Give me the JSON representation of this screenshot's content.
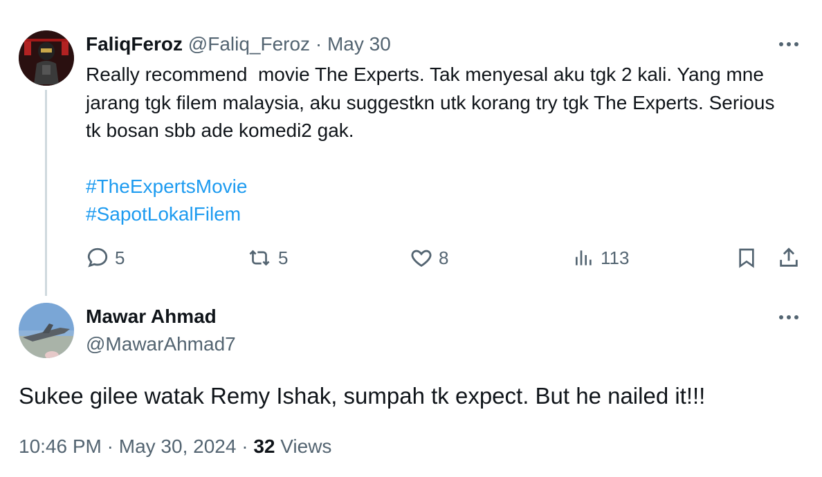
{
  "parent_tweet": {
    "display_name": "FaliqFeroz",
    "handle": "@Faliq_Feroz",
    "separator": "·",
    "date": "May 30",
    "text": "Really recommend  movie The Experts. Tak menyesal aku tgk 2 kali. Yang mne jarang tgk filem malaysia, aku suggestkn utk korang try tgk The Experts. Serious tk bosan sbb ade komedi2 gak.",
    "hashtags": [
      "#TheExpertsMovie",
      "#SapotLokalFilem"
    ],
    "actions": {
      "replies": "5",
      "reposts": "5",
      "likes": "8",
      "views": "113"
    }
  },
  "reply_tweet": {
    "display_name": "Mawar Ahmad",
    "handle": "@MawarAhmad7",
    "text": "Sukee gilee watak Remy Ishak, sumpah tk expect. But he nailed it!!!",
    "time": "10:46 PM",
    "separator": "·",
    "date": "May 30, 2024",
    "views_count": "32",
    "views_label": "Views"
  },
  "colors": {
    "text": "#0f1419",
    "muted": "#536471",
    "link": "#1d9bf0",
    "thread_line": "#cfd9de"
  },
  "icons": [
    "more-icon",
    "reply-icon",
    "repost-icon",
    "like-icon",
    "views-icon",
    "bookmark-icon",
    "share-icon"
  ]
}
